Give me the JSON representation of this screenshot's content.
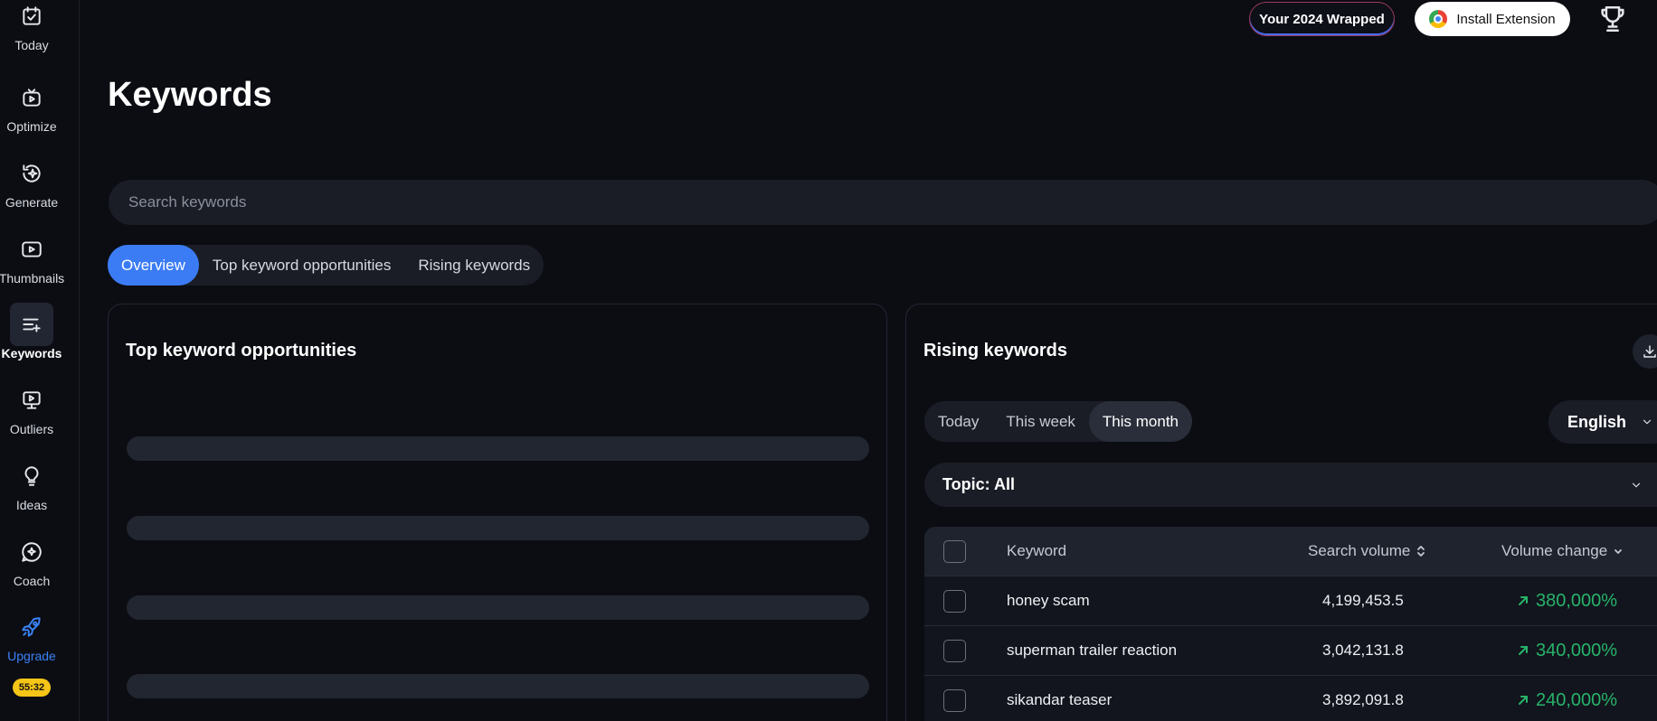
{
  "sidebar": {
    "items": [
      {
        "label": "Today",
        "icon": "calendar-check-icon"
      },
      {
        "label": "Optimize",
        "icon": "video-optimize-icon"
      },
      {
        "label": "Generate",
        "icon": "sparkle-refresh-icon"
      },
      {
        "label": "Thumbnails",
        "icon": "thumbnail-play-icon"
      },
      {
        "label": "Keywords",
        "icon": "list-plus-icon"
      },
      {
        "label": "Outliers",
        "icon": "monitor-play-icon"
      },
      {
        "label": "Ideas",
        "icon": "lightbulb-icon"
      },
      {
        "label": "Coach",
        "icon": "chat-sparkle-icon"
      },
      {
        "label": "Upgrade",
        "icon": "rocket-icon"
      }
    ],
    "active": "Keywords",
    "timer": "55:32",
    "upgrade_color": "#3b82f6"
  },
  "header": {
    "wrapped_label": "Your 2024 Wrapped",
    "install_label": "Install Extension"
  },
  "page": {
    "title": "Keywords"
  },
  "search": {
    "placeholder": "Search keywords",
    "value": ""
  },
  "tabs": [
    {
      "label": "Overview",
      "active": true
    },
    {
      "label": "Top keyword opportunities",
      "active": false
    },
    {
      "label": "Rising keywords",
      "active": false
    }
  ],
  "opportunities_card": {
    "title": "Top keyword opportunities"
  },
  "rising_card": {
    "title": "Rising keywords",
    "periods": [
      "Today",
      "This week",
      "This month"
    ],
    "active_period": "This month",
    "language": "English",
    "topic": "Topic: All",
    "columns": {
      "keyword": "Keyword",
      "search_volume": "Search volume",
      "volume_change": "Volume change"
    },
    "rows": [
      {
        "keyword": "honey scam",
        "search_volume": "4,199,453.5",
        "volume_change": "380,000%"
      },
      {
        "keyword": "superman trailer reaction",
        "search_volume": "3,042,131.8",
        "volume_change": "340,000%"
      },
      {
        "keyword": "sikandar teaser",
        "search_volume": "3,892,091.8",
        "volume_change": "240,000%"
      }
    ],
    "positive_color": "#27b36a"
  },
  "colors": {
    "accent": "#3b7cf5",
    "background": "#0b0d13"
  }
}
